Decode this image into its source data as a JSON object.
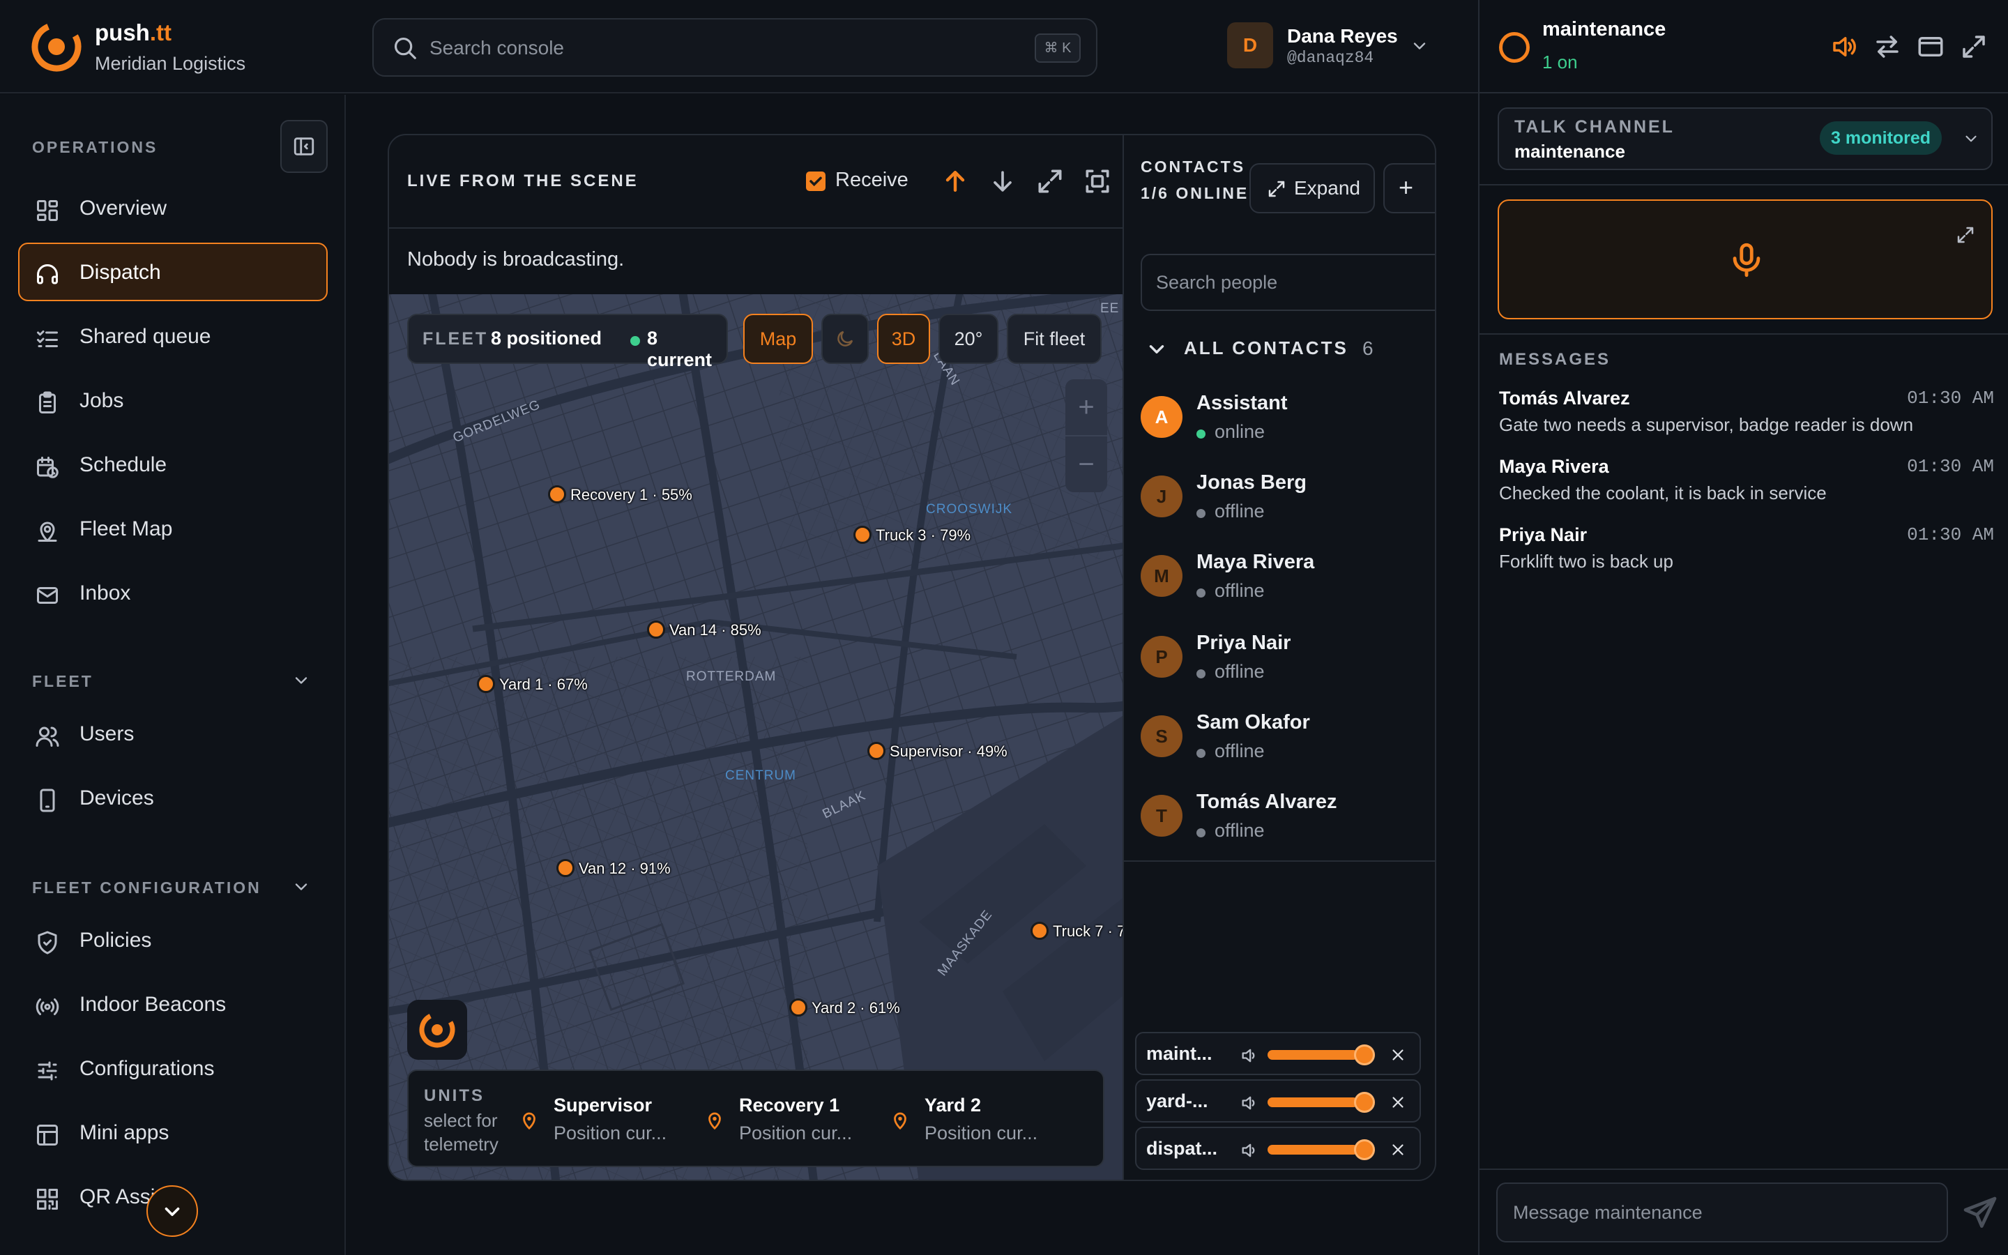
{
  "app": {
    "brand_name": "push",
    "brand_suffix": ".tt",
    "org": "Meridian Logistics"
  },
  "search": {
    "placeholder": "Search console",
    "shortcut": "⌘ K"
  },
  "user": {
    "initial": "D",
    "name": "Dana Reyes",
    "handle": "@danaqz84"
  },
  "sidebar": {
    "operations_label": "OPERATIONS",
    "operations": [
      {
        "label": "Overview",
        "icon": "grid-icon"
      },
      {
        "label": "Dispatch",
        "icon": "headset-icon",
        "active": true
      },
      {
        "label": "Shared queue",
        "icon": "checklist-icon"
      },
      {
        "label": "Jobs",
        "icon": "clipboard-icon"
      },
      {
        "label": "Schedule",
        "icon": "calendar-clock-icon"
      },
      {
        "label": "Fleet Map",
        "icon": "map-pin-icon"
      },
      {
        "label": "Inbox",
        "icon": "mail-icon"
      }
    ],
    "fleet_label": "FLEET",
    "fleet": [
      {
        "label": "Users",
        "icon": "users-icon"
      },
      {
        "label": "Devices",
        "icon": "phone-icon"
      }
    ],
    "config_label": "FLEET CONFIGURATION",
    "config": [
      {
        "label": "Policies",
        "icon": "shield-icon"
      },
      {
        "label": "Indoor Beacons",
        "icon": "broadcast-icon"
      },
      {
        "label": "Configurations",
        "icon": "sliders-icon"
      },
      {
        "label": "Mini apps",
        "icon": "layout-icon"
      },
      {
        "label": "QR Assi",
        "icon": "qr-icon"
      }
    ]
  },
  "scene": {
    "title": "LIVE FROM THE SCENE",
    "receive_label": "Receive",
    "receive_checked": true,
    "broadcast_status": "Nobody is broadcasting."
  },
  "map": {
    "fleet_label": "FLEET",
    "positioned": "8 positioned",
    "current": "8 current",
    "buttons": {
      "map": "Map",
      "three_d": "3D",
      "tilt": "20°",
      "fit": "Fit fleet"
    },
    "zoom_in": "+",
    "zoom_out": "−",
    "pins": [
      "Recovery 1 · 55%",
      "Truck 3 · 79%",
      "Van 14 · 85%",
      "Yard 1 · 67%",
      "Supervisor · 49%",
      "Van 12 · 91%",
      "Truck 7 · 7",
      "Yard 2 · 61%"
    ],
    "labels": [
      "GORDELWEG",
      "CROOSWIJK",
      "ROTTERDAM",
      "CENTRUM",
      "BLAAK",
      "MAASKADE",
      "LAAN",
      "EE"
    ]
  },
  "units": {
    "title": "UNITS",
    "subtitle": "select for telemetry",
    "items": [
      {
        "name": "Supervisor",
        "detail": "Position cur..."
      },
      {
        "name": "Recovery 1",
        "detail": "Position cur..."
      },
      {
        "name": "Yard 2",
        "detail": "Position cur..."
      }
    ]
  },
  "contacts": {
    "title": "CONTACTS · 1/6 ONLINE",
    "expand_label": "Expand",
    "add_label": "+",
    "search_placeholder": "Search people",
    "group_label": "ALL CONTACTS",
    "group_count": "6",
    "people": [
      {
        "initial": "A",
        "name": "Assistant",
        "status": "online"
      },
      {
        "initial": "J",
        "name": "Jonas Berg",
        "status": "offline"
      },
      {
        "initial": "M",
        "name": "Maya Rivera",
        "status": "offline"
      },
      {
        "initial": "P",
        "name": "Priya Nair",
        "status": "offline"
      },
      {
        "initial": "S",
        "name": "Sam Okafor",
        "status": "offline"
      },
      {
        "initial": "T",
        "name": "Tomás Alvarez",
        "status": "offline"
      }
    ],
    "channels": [
      {
        "name": "maint...",
        "volume": 0.95
      },
      {
        "name": "yard-...",
        "volume": 0.95
      },
      {
        "name": "dispat...",
        "volume": 0.95
      }
    ]
  },
  "channel": {
    "name": "maintenance",
    "status": "1 on",
    "talk_label": "TALK CHANNEL",
    "talk_value": "maintenance",
    "monitored": "3 monitored",
    "messages_label": "MESSAGES",
    "messages": [
      {
        "author": "Tomás Alvarez",
        "time": "01:30 AM",
        "text": "Gate two needs a supervisor, badge reader is down"
      },
      {
        "author": "Maya Rivera",
        "time": "01:30 AM",
        "text": "Checked the coolant, it is back in service"
      },
      {
        "author": "Priya Nair",
        "time": "01:30 AM",
        "text": "Forklift two is back up"
      }
    ],
    "input_placeholder": "Message maintenance"
  },
  "colors": {
    "accent": "#f5821f",
    "online": "#3ecf8e",
    "monitored": "#40d6c8",
    "background": "#0d1117",
    "map": "#3b4358"
  }
}
